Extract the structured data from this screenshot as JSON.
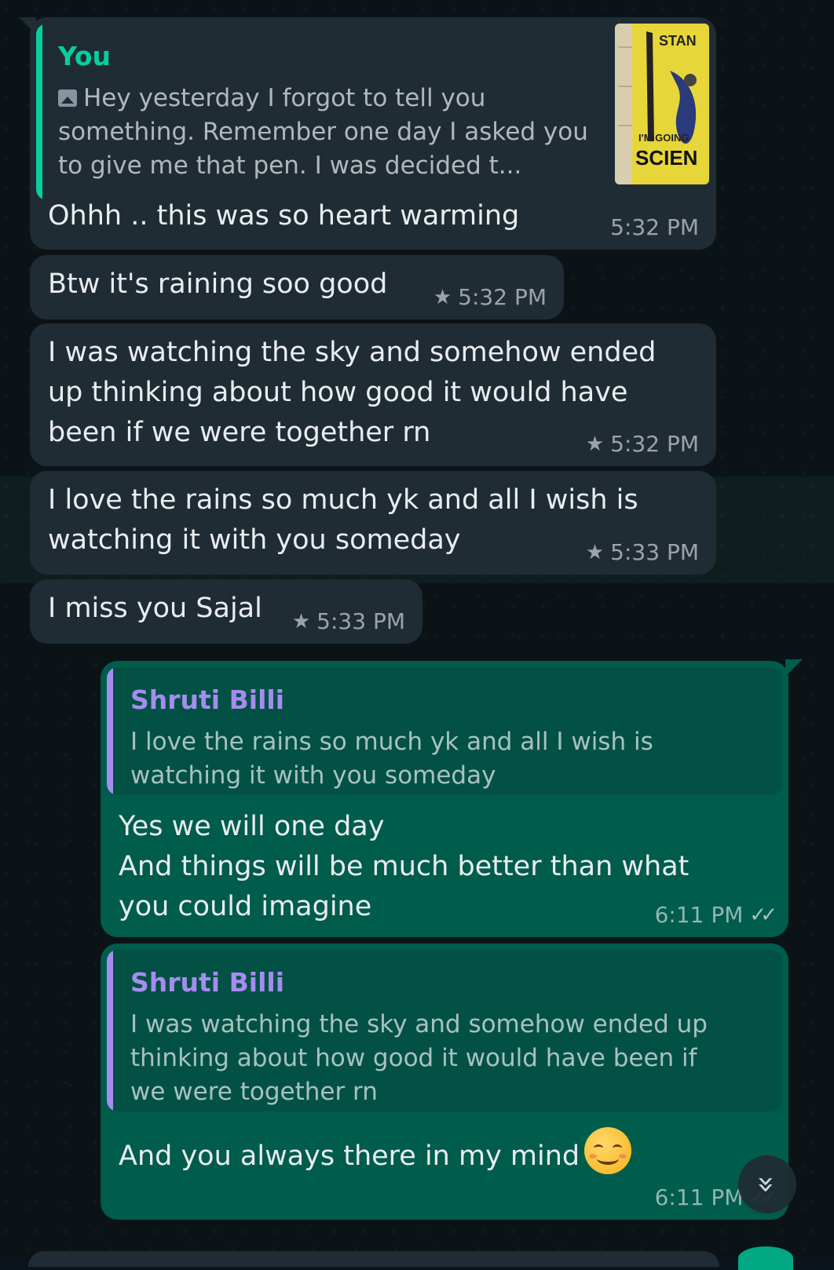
{
  "theme": {
    "incoming_bubble": "#202c33",
    "outgoing_bubble": "#005c4b",
    "quote_you_accent": "#06cf9c",
    "quote_contact_accent": "#a58cf0"
  },
  "messages": [
    {
      "direction": "incoming",
      "quote": {
        "author": "You",
        "media_icon": "photo-icon",
        "text": "Hey yesterday I forgot to tell you something. Remember one day I asked you to give me that pen. I was decided t...",
        "thumbnail_text": [
          "STAN",
          "I'M GOING",
          "SCIEN"
        ]
      },
      "text": "Ohhh .. this was so heart warming",
      "time": "5:32 PM",
      "starred": false
    },
    {
      "direction": "incoming",
      "text": "Btw it's raining soo good",
      "time": "5:32 PM",
      "starred": true
    },
    {
      "direction": "incoming",
      "text": "I was watching the sky and somehow ended\nup thinking about how good it would have\nbeen if we were together rn",
      "time": "5:32 PM",
      "starred": true
    },
    {
      "direction": "incoming",
      "text": "I love the rains so much yk and all I wish is\nwatching it with you someday",
      "time": "5:33 PM",
      "starred": true
    },
    {
      "direction": "incoming",
      "text": "I miss you Sajal",
      "time": "5:33 PM",
      "starred": true
    },
    {
      "direction": "outgoing",
      "quote": {
        "author": "Shruti Billi",
        "text": "I love the rains so much yk and all I wish is\nwatching it with you someday"
      },
      "text": "Yes  we will one day\nAnd things will be much better than what\nyou could imagine",
      "time": "6:11 PM",
      "status": "read"
    },
    {
      "direction": "outgoing",
      "quote": {
        "author": "Shruti Billi",
        "text": "I was watching the sky and somehow ended up\nthinking about how good it would have been if\nwe were together rn"
      },
      "text": "And you always there in my mind",
      "emoji": "smiling-face-with-smiling-eyes",
      "time": "6:11 PM",
      "status": "read"
    }
  ],
  "icons": {
    "star": "★",
    "double_tick": "✓✓",
    "scroll_down": "»"
  }
}
